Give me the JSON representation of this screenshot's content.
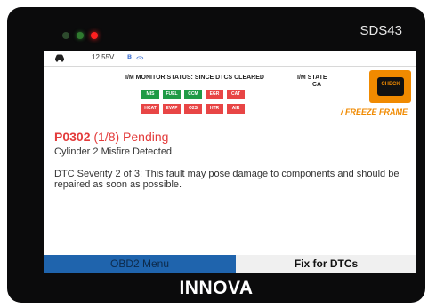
{
  "device": {
    "model": "SDS43",
    "brand": "INNOVA"
  },
  "statusbar": {
    "car_icon": "car-icon",
    "voltage": "12.55V",
    "bluetooth": "ʙ",
    "wifi": "ᯅ"
  },
  "monitor": {
    "title": "I/M MONITOR STATUS: SINCE DTCS CLEARED",
    "state_label": "I/M STATE",
    "state_value": "CA",
    "row1": [
      {
        "label": "MIS",
        "status": "green"
      },
      {
        "label": "FUEL",
        "status": "green"
      },
      {
        "label": "CCM",
        "status": "green"
      },
      {
        "label": "EGR",
        "status": "red"
      },
      {
        "label": "CAT",
        "status": "red"
      }
    ],
    "row2": [
      {
        "label": "HCAT",
        "status": "red"
      },
      {
        "label": "EVAP",
        "status": "red"
      },
      {
        "label": "O2S",
        "status": "red"
      },
      {
        "label": "HTR",
        "status": "red"
      },
      {
        "label": "AIR",
        "status": "red"
      }
    ]
  },
  "check_engine": {
    "icon": "check-engine-icon",
    "text": "CHECK",
    "freeze_frame": "/ FREEZE FRAME"
  },
  "dtc": {
    "code": "P0302",
    "status": "(1/8) Pending",
    "description": "Cylinder 2 Misfire Detected",
    "severity": "DTC Severity 2 of 3: This fault may pose damage to components and should be repaired as soon as possible."
  },
  "buttons": {
    "menu": "OBD2 Menu",
    "fix": "Fix for DTCs"
  },
  "colors": {
    "accent_blue": "#1f64ad",
    "dtc_red": "#e33b3b",
    "orange": "#f08a00",
    "monitor_green": "#1f9a45",
    "monitor_red": "#e84545"
  }
}
